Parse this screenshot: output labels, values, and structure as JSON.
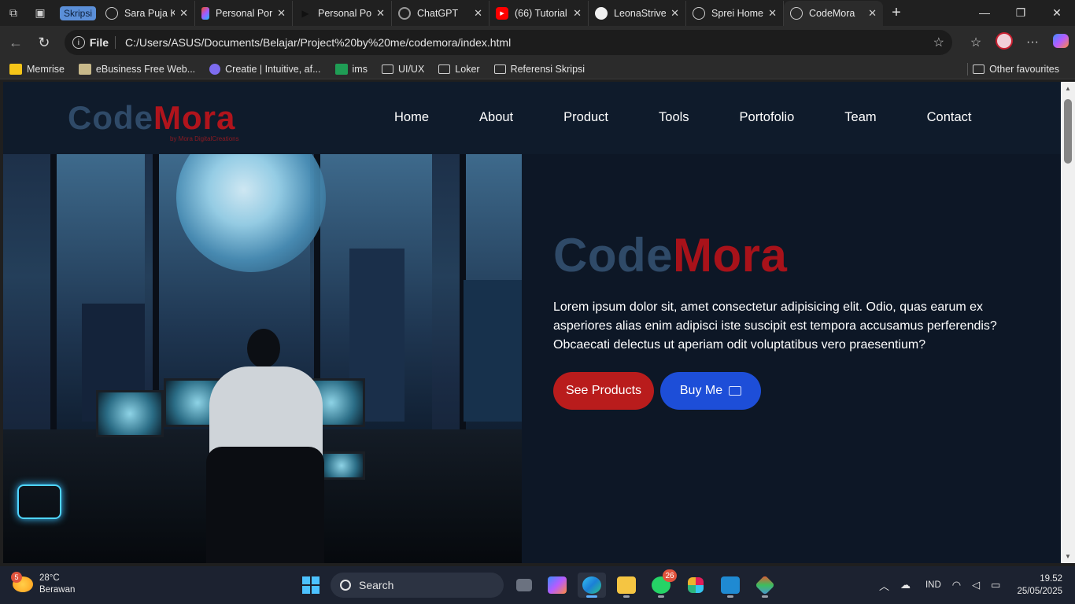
{
  "browser": {
    "group_label": "Skripsi",
    "tabs": [
      {
        "title": "Sara Puja Ke",
        "favicon": "globe-icon"
      },
      {
        "title": "Personal Por",
        "favicon": "figma-icon"
      },
      {
        "title": "Personal Por",
        "favicon": "play-icon"
      },
      {
        "title": "ChatGPT",
        "favicon": "chatgpt-icon"
      },
      {
        "title": "(66) Tutorial",
        "favicon": "youtube-icon"
      },
      {
        "title": "LeonaStrive",
        "favicon": "github-icon"
      },
      {
        "title": "Sprei Home",
        "favicon": "globe-icon"
      },
      {
        "title": "CodeMora",
        "favicon": "globe-icon",
        "active": true
      }
    ],
    "address": {
      "scheme_label": "File",
      "url": "C:/Users/ASUS/Documents/Belajar/Project%20by%20me/codemora/index.html"
    },
    "bookmarks": [
      "Memrise",
      "eBusiness Free Web...",
      "Creatie | Intuitive, af...",
      "ims",
      "UI/UX",
      "Loker",
      "Referensi Skripsi"
    ],
    "other_favourites": "Other favourites"
  },
  "page": {
    "logo": {
      "part1": "Code",
      "part2": "Mora",
      "tagline": "by Mora DigitalCreations"
    },
    "nav": [
      "Home",
      "About",
      "Product",
      "Tools",
      "Portofolio",
      "Team",
      "Contact"
    ],
    "hero": {
      "title_part1": "Code",
      "title_part2": "Mora",
      "paragraph": "Lorem ipsum dolor sit, amet consectetur adipisicing elit. Odio, quas earum ex asperiores alias enim adipisci iste suscipit est tempora accusamus perferendis? Obcaecati delectus ut aperiam odit voluptatibus vero praesentium?",
      "primary_button": "See Products",
      "secondary_button": "Buy Me"
    },
    "colors": {
      "brand_blue": "#2f4a68",
      "brand_red": "#b0141c",
      "bg": "#0d1726",
      "btn_red": "#b91c1c",
      "btn_blue": "#1d4ed8"
    }
  },
  "taskbar": {
    "weather": {
      "temp": "28°C",
      "condition": "Berawan",
      "badge": "5"
    },
    "search_label": "Search",
    "whatsapp_badge": "26",
    "lang": "IND",
    "time": "19.52",
    "date": "25/05/2025"
  }
}
